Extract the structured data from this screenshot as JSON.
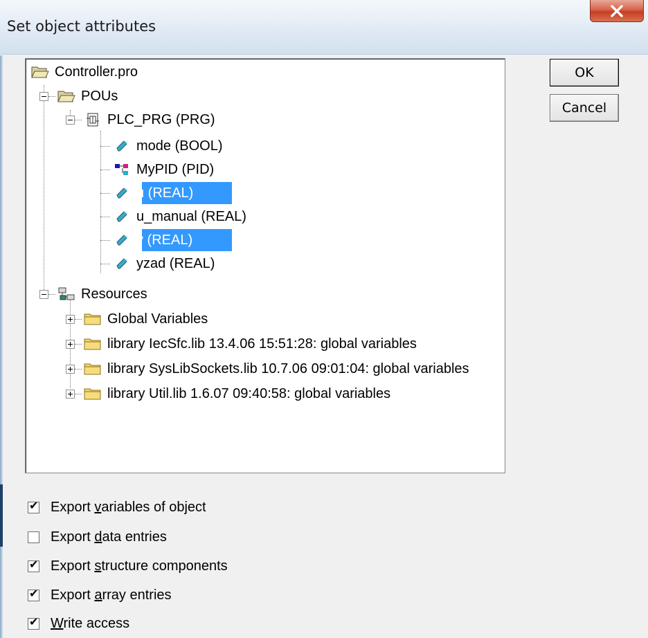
{
  "window": {
    "title": "Set object attributes",
    "close_icon": "close-x-icon"
  },
  "buttons": {
    "ok": "OK",
    "cancel": "Cancel"
  },
  "tree": {
    "root": "Controller.pro",
    "pous": "POUs",
    "plc_prg": "PLC_PRG (PRG)",
    "vars": [
      {
        "label": "mode (BOOL)",
        "icon": "variable-icon",
        "selected": false
      },
      {
        "label": "MyPID (PID)",
        "icon": "function-block-icon",
        "selected": false
      },
      {
        "label": "u (REAL)",
        "icon": "variable-icon",
        "selected": true
      },
      {
        "label": "u_manual (REAL)",
        "icon": "variable-icon",
        "selected": false
      },
      {
        "label": "y (REAL)",
        "icon": "variable-icon",
        "selected": true
      },
      {
        "label": "yzad (REAL)",
        "icon": "variable-icon",
        "selected": false
      }
    ],
    "resources": "Resources",
    "resource_items": [
      "Global Variables",
      "library IecSfc.lib 13.4.06 15:51:28: global variables",
      "library SysLibSockets.lib 10.7.06 09:01:04: global variables",
      "library Util.lib 1.6.07 09:40:58: global variables"
    ]
  },
  "options": [
    {
      "pre": "Export ",
      "key": "v",
      "post": "ariables of object",
      "checked": true
    },
    {
      "pre": "Export ",
      "key": "d",
      "post": "ata entries",
      "checked": false
    },
    {
      "pre": "Export ",
      "key": "s",
      "post": "tructure components",
      "checked": true
    },
    {
      "pre": "Export ",
      "key": "a",
      "post": "rray entries",
      "checked": true
    },
    {
      "pre": "",
      "key": "W",
      "post": "rite access",
      "checked": true
    }
  ],
  "colors": {
    "selection": "#3399ff",
    "close_button": "#c9462c"
  }
}
